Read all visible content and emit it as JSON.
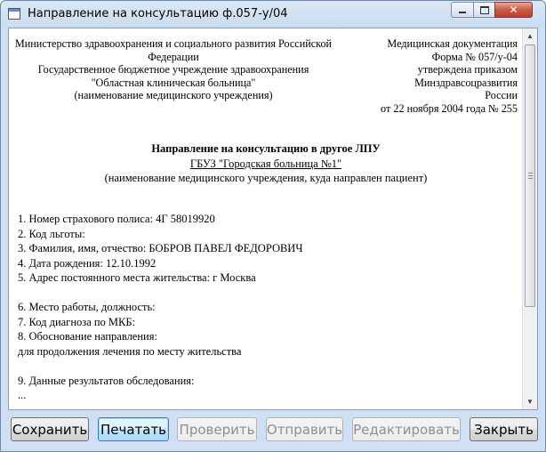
{
  "window": {
    "title": "Направление на консультацию ф.057-у/04",
    "controls": {
      "minimize": "minimize-icon",
      "maximize": "maximize-icon",
      "close": "close-icon"
    }
  },
  "document": {
    "header_left": [
      "Министерство здравоохранения и социального развития Российской",
      "Федерации",
      "Государственное бюджетное учреждение здравоохранения",
      "\"Областная клиническая больница\"",
      "(наименование медицинского учреждения)"
    ],
    "header_right": [
      "Медицинская документация",
      "Форма № 057/у-04",
      "утверждена приказом Минздравсоцразвития",
      "России",
      "от 22 ноября 2004 года № 255"
    ],
    "title": "Направление на консультацию в другое ЛПУ",
    "destination": "ГБУЗ \"Городская больница №1\"",
    "destination_caption": "(наименование медицинского учреждения, куда направлен пациент)",
    "fields": [
      "1. Номер страхового полиса: 4Г 58019920",
      "2. Код льготы:",
      "3. Фамилия, имя, отчество: БОБРОВ ПАВЕЛ ФЕДОРОВИЧ",
      "4. Дата рождения: 12.10.1992",
      "5. Адрес постоянного места жительства:  г Москва",
      "",
      "6. Место работы, должность:",
      "7. Код диагноза по МКБ:",
      "8. Обоснование направления:",
      "для продолжения лечения по месту жительства",
      "",
      "9. Данные результатов обследования:",
      "..."
    ]
  },
  "buttons": {
    "save": "Сохранить",
    "print": "Печатать",
    "check": "Проверить",
    "send": "Отправить",
    "edit": "Редактировать",
    "close": "Закрыть"
  },
  "colors": {
    "window_frame": "#cfe0f2",
    "close_button": "#c85b43",
    "disabled_text": "#8f8f8f"
  }
}
